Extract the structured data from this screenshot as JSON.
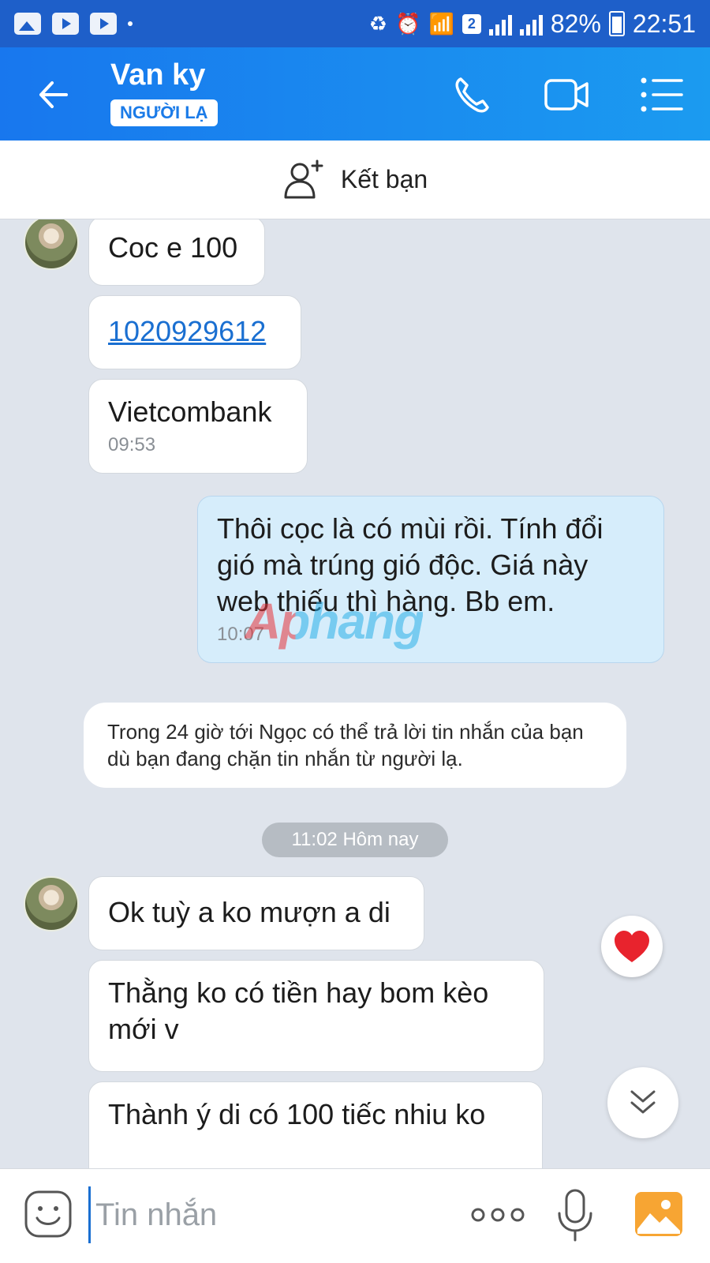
{
  "status_bar": {
    "battery": "82%",
    "time": "22:51",
    "sim_badge": "2"
  },
  "header": {
    "contact_name": "Van ky",
    "badge": "NGƯỜI LẠ"
  },
  "add_friend": {
    "label": "Kết bạn"
  },
  "messages": [
    {
      "sender": "Van ky",
      "text": "Coc e 100"
    },
    {
      "sender": "Van ky",
      "text": "1020929612"
    },
    {
      "sender": "Van ky",
      "text": "Vietcombank",
      "time": "09:53"
    },
    {
      "sender": "me",
      "text": "Thôi cọc là có mùi rồi. Tính đổi gió mà trúng gió độc. Giá này web thiếu thì hàng. Bb em.",
      "time": "10:07"
    },
    {
      "sender": "Van ky",
      "text": "Ok tuỳ a ko mượn a di"
    },
    {
      "sender": "Van ky",
      "text": "Thằng ko có tiền hay bom kèo mới v"
    },
    {
      "sender": "Van ky",
      "text": "Thành ý di có 100 tiếc nhiu ko"
    }
  ],
  "system_note": "Trong 24 giờ tới Ngọc có thể trả lời tin nhắn của bạn dù bạn đang chặn tin nhắn từ người lạ.",
  "date_separator": "11:02 Hôm nay",
  "watermark": "Aphang",
  "input": {
    "placeholder": "Tin nhắn",
    "value": ""
  },
  "colors": {
    "header_start": "#1877ee",
    "header_end": "#1b9bf0",
    "my_bubble": "#d6edfb",
    "link": "#1a6fd1",
    "heart": "#e8232d"
  },
  "icons": [
    "back-arrow-icon",
    "phone-icon",
    "video-icon",
    "menu-icon",
    "add-user-icon",
    "heart-icon",
    "double-chevron-down-icon",
    "emoji-icon",
    "more-dots-icon",
    "mic-icon",
    "photo-icon"
  ]
}
